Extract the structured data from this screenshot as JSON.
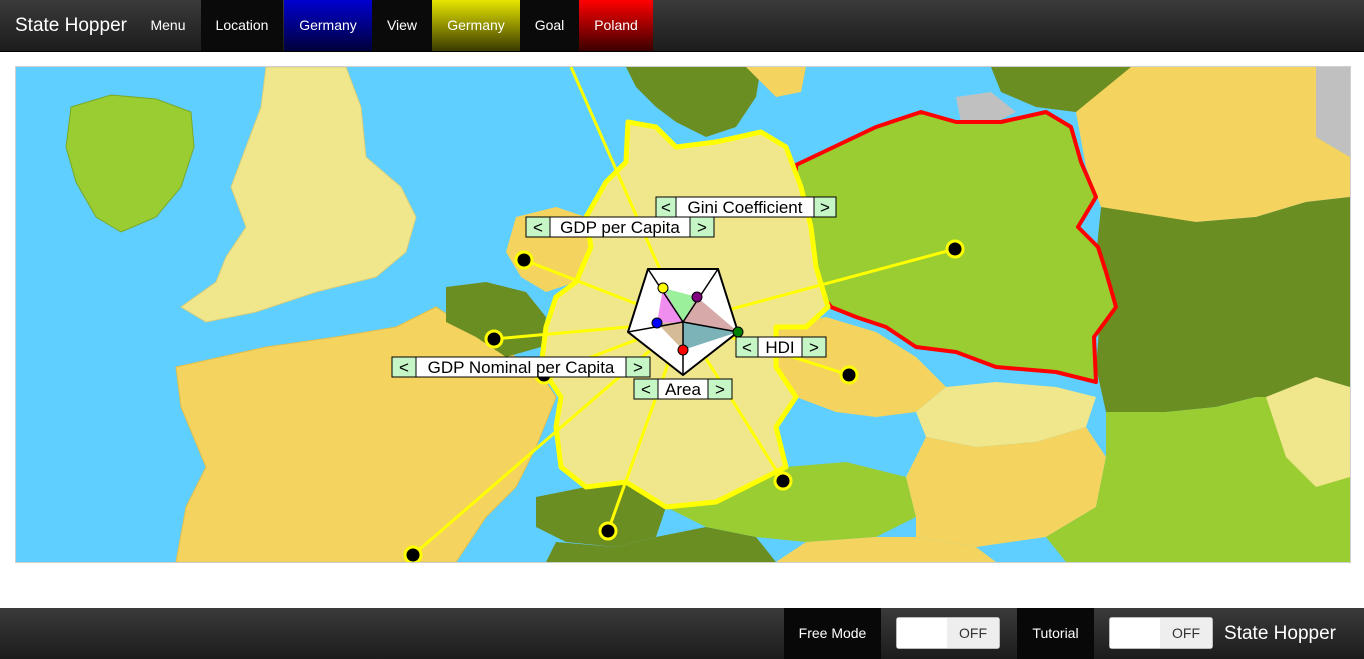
{
  "app": {
    "title": "State Hopper"
  },
  "nav": {
    "menu_label": "Menu",
    "location_label": "Location",
    "location_value": "Germany",
    "view_label": "View",
    "view_value": "Germany",
    "goal_label": "Goal",
    "goal_value": "Poland"
  },
  "colors": {
    "location_accent": "#0000aa",
    "view_accent": "#c8c800",
    "goal_accent": "#d00000",
    "sea": "#5ecfff",
    "highlight_border_view": "#ffff00",
    "highlight_border_goal": "#ff0000"
  },
  "map": {
    "selected_country": "Germany",
    "goal_country": "Poland",
    "stat_labels": {
      "gini": "Gini Coefficient",
      "gdp_pc": "GDP per Capita",
      "hdi": "HDI",
      "gdp_nominal_pc": "GDP Nominal per Capita",
      "area": "Area"
    },
    "arrow_prev": "<",
    "arrow_next": ">"
  },
  "footer": {
    "free_mode_label": "Free Mode",
    "free_mode_state": "OFF",
    "tutorial_label": "Tutorial",
    "tutorial_state": "OFF",
    "brand": "State Hopper"
  }
}
